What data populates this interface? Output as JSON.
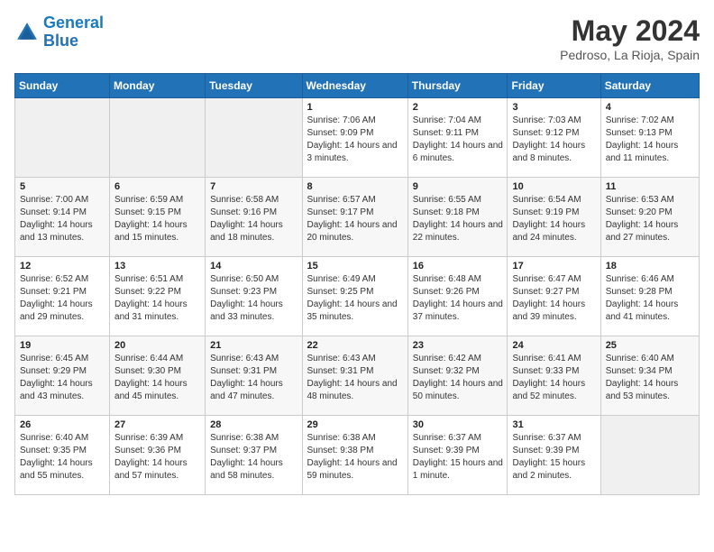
{
  "header": {
    "logo_general": "General",
    "logo_blue": "Blue",
    "month_title": "May 2024",
    "location": "Pedroso, La Rioja, Spain"
  },
  "days_of_week": [
    "Sunday",
    "Monday",
    "Tuesday",
    "Wednesday",
    "Thursday",
    "Friday",
    "Saturday"
  ],
  "weeks": [
    [
      {
        "day": "",
        "sunrise": "",
        "sunset": "",
        "daylight": "",
        "empty": true
      },
      {
        "day": "",
        "sunrise": "",
        "sunset": "",
        "daylight": "",
        "empty": true
      },
      {
        "day": "",
        "sunrise": "",
        "sunset": "",
        "daylight": "",
        "empty": true
      },
      {
        "day": "1",
        "sunrise": "Sunrise: 7:06 AM",
        "sunset": "Sunset: 9:09 PM",
        "daylight": "Daylight: 14 hours and 3 minutes."
      },
      {
        "day": "2",
        "sunrise": "Sunrise: 7:04 AM",
        "sunset": "Sunset: 9:11 PM",
        "daylight": "Daylight: 14 hours and 6 minutes."
      },
      {
        "day": "3",
        "sunrise": "Sunrise: 7:03 AM",
        "sunset": "Sunset: 9:12 PM",
        "daylight": "Daylight: 14 hours and 8 minutes."
      },
      {
        "day": "4",
        "sunrise": "Sunrise: 7:02 AM",
        "sunset": "Sunset: 9:13 PM",
        "daylight": "Daylight: 14 hours and 11 minutes."
      }
    ],
    [
      {
        "day": "5",
        "sunrise": "Sunrise: 7:00 AM",
        "sunset": "Sunset: 9:14 PM",
        "daylight": "Daylight: 14 hours and 13 minutes."
      },
      {
        "day": "6",
        "sunrise": "Sunrise: 6:59 AM",
        "sunset": "Sunset: 9:15 PM",
        "daylight": "Daylight: 14 hours and 15 minutes."
      },
      {
        "day": "7",
        "sunrise": "Sunrise: 6:58 AM",
        "sunset": "Sunset: 9:16 PM",
        "daylight": "Daylight: 14 hours and 18 minutes."
      },
      {
        "day": "8",
        "sunrise": "Sunrise: 6:57 AM",
        "sunset": "Sunset: 9:17 PM",
        "daylight": "Daylight: 14 hours and 20 minutes."
      },
      {
        "day": "9",
        "sunrise": "Sunrise: 6:55 AM",
        "sunset": "Sunset: 9:18 PM",
        "daylight": "Daylight: 14 hours and 22 minutes."
      },
      {
        "day": "10",
        "sunrise": "Sunrise: 6:54 AM",
        "sunset": "Sunset: 9:19 PM",
        "daylight": "Daylight: 14 hours and 24 minutes."
      },
      {
        "day": "11",
        "sunrise": "Sunrise: 6:53 AM",
        "sunset": "Sunset: 9:20 PM",
        "daylight": "Daylight: 14 hours and 27 minutes."
      }
    ],
    [
      {
        "day": "12",
        "sunrise": "Sunrise: 6:52 AM",
        "sunset": "Sunset: 9:21 PM",
        "daylight": "Daylight: 14 hours and 29 minutes."
      },
      {
        "day": "13",
        "sunrise": "Sunrise: 6:51 AM",
        "sunset": "Sunset: 9:22 PM",
        "daylight": "Daylight: 14 hours and 31 minutes."
      },
      {
        "day": "14",
        "sunrise": "Sunrise: 6:50 AM",
        "sunset": "Sunset: 9:23 PM",
        "daylight": "Daylight: 14 hours and 33 minutes."
      },
      {
        "day": "15",
        "sunrise": "Sunrise: 6:49 AM",
        "sunset": "Sunset: 9:25 PM",
        "daylight": "Daylight: 14 hours and 35 minutes."
      },
      {
        "day": "16",
        "sunrise": "Sunrise: 6:48 AM",
        "sunset": "Sunset: 9:26 PM",
        "daylight": "Daylight: 14 hours and 37 minutes."
      },
      {
        "day": "17",
        "sunrise": "Sunrise: 6:47 AM",
        "sunset": "Sunset: 9:27 PM",
        "daylight": "Daylight: 14 hours and 39 minutes."
      },
      {
        "day": "18",
        "sunrise": "Sunrise: 6:46 AM",
        "sunset": "Sunset: 9:28 PM",
        "daylight": "Daylight: 14 hours and 41 minutes."
      }
    ],
    [
      {
        "day": "19",
        "sunrise": "Sunrise: 6:45 AM",
        "sunset": "Sunset: 9:29 PM",
        "daylight": "Daylight: 14 hours and 43 minutes."
      },
      {
        "day": "20",
        "sunrise": "Sunrise: 6:44 AM",
        "sunset": "Sunset: 9:30 PM",
        "daylight": "Daylight: 14 hours and 45 minutes."
      },
      {
        "day": "21",
        "sunrise": "Sunrise: 6:43 AM",
        "sunset": "Sunset: 9:31 PM",
        "daylight": "Daylight: 14 hours and 47 minutes."
      },
      {
        "day": "22",
        "sunrise": "Sunrise: 6:43 AM",
        "sunset": "Sunset: 9:31 PM",
        "daylight": "Daylight: 14 hours and 48 minutes."
      },
      {
        "day": "23",
        "sunrise": "Sunrise: 6:42 AM",
        "sunset": "Sunset: 9:32 PM",
        "daylight": "Daylight: 14 hours and 50 minutes."
      },
      {
        "day": "24",
        "sunrise": "Sunrise: 6:41 AM",
        "sunset": "Sunset: 9:33 PM",
        "daylight": "Daylight: 14 hours and 52 minutes."
      },
      {
        "day": "25",
        "sunrise": "Sunrise: 6:40 AM",
        "sunset": "Sunset: 9:34 PM",
        "daylight": "Daylight: 14 hours and 53 minutes."
      }
    ],
    [
      {
        "day": "26",
        "sunrise": "Sunrise: 6:40 AM",
        "sunset": "Sunset: 9:35 PM",
        "daylight": "Daylight: 14 hours and 55 minutes."
      },
      {
        "day": "27",
        "sunrise": "Sunrise: 6:39 AM",
        "sunset": "Sunset: 9:36 PM",
        "daylight": "Daylight: 14 hours and 57 minutes."
      },
      {
        "day": "28",
        "sunrise": "Sunrise: 6:38 AM",
        "sunset": "Sunset: 9:37 PM",
        "daylight": "Daylight: 14 hours and 58 minutes."
      },
      {
        "day": "29",
        "sunrise": "Sunrise: 6:38 AM",
        "sunset": "Sunset: 9:38 PM",
        "daylight": "Daylight: 14 hours and 59 minutes."
      },
      {
        "day": "30",
        "sunrise": "Sunrise: 6:37 AM",
        "sunset": "Sunset: 9:39 PM",
        "daylight": "Daylight: 15 hours and 1 minute."
      },
      {
        "day": "31",
        "sunrise": "Sunrise: 6:37 AM",
        "sunset": "Sunset: 9:39 PM",
        "daylight": "Daylight: 15 hours and 2 minutes."
      },
      {
        "day": "",
        "sunrise": "",
        "sunset": "",
        "daylight": "",
        "empty": true
      }
    ]
  ]
}
